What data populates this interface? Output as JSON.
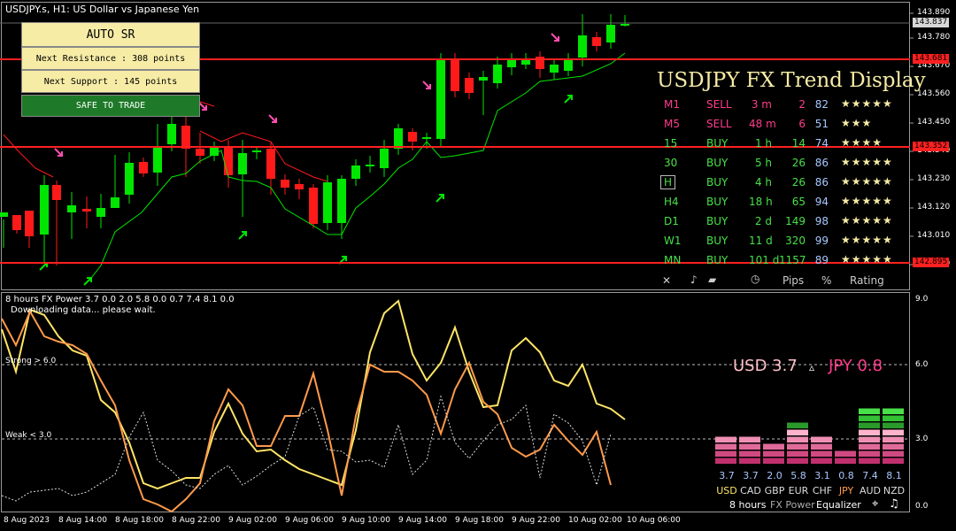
{
  "header": {
    "symbol_title": "USDJPY.s, H1:  US Dollar vs Japanese Yen",
    "indicator_title": "8 hours FX Power 3.7 0.0 2.0 5.8 0.0 0.7 7.4 8.1 0.0",
    "status_message": "Downloading data... please wait."
  },
  "sr_panel": {
    "auto_sr": "AUTO  SR",
    "next_resistance": "Next Resistance : 308 points",
    "next_support": "Next Support : 145 points",
    "safe_to_trade": "SAFE TO TRADE"
  },
  "price_axis": {
    "ticks": [
      "143.890",
      "143.780",
      "143.670",
      "143.560",
      "143.450",
      "143.340",
      "143.230",
      "143.120",
      "143.010",
      "142.900"
    ],
    "current_price_tag": "143.837",
    "resistance_tag": "143.681",
    "mid_tag": "143.352",
    "support_tag": "142.895"
  },
  "trend_display": {
    "title": "USDJPY FX Trend Display",
    "rows": [
      {
        "tf": "M1",
        "dir": "SELL",
        "time": "3 m",
        "pips": "2",
        "pct": "82",
        "stars": "★★★★★",
        "color": "#ff3c8c"
      },
      {
        "tf": "M5",
        "dir": "SELL",
        "time": "48 m",
        "pips": "6",
        "pct": "51",
        "stars": "★★★",
        "color": "#ff3c8c"
      },
      {
        "tf": "15",
        "dir": "BUY",
        "time": "1 h",
        "pips": "14",
        "pct": "74",
        "stars": "★★★★",
        "color": "#48e048"
      },
      {
        "tf": "30",
        "dir": "BUY",
        "time": "5 h",
        "pips": "26",
        "pct": "86",
        "stars": "★★★★★",
        "color": "#48e048"
      },
      {
        "tf": "H",
        "dir": "BUY",
        "time": "4 h",
        "pips": "26",
        "pct": "86",
        "stars": "★★★★★",
        "color": "#48e048"
      },
      {
        "tf": "H4",
        "dir": "BUY",
        "time": "18 h",
        "pips": "65",
        "pct": "94",
        "stars": "★★★★★",
        "color": "#48e048"
      },
      {
        "tf": "D1",
        "dir": "BUY",
        "time": "2 d",
        "pips": "149",
        "pct": "98",
        "stars": "★★★★★",
        "color": "#48e048"
      },
      {
        "tf": "W1",
        "dir": "BUY",
        "time": "11 d",
        "pips": "320",
        "pct": "99",
        "stars": "★★★★★",
        "color": "#48e048"
      },
      {
        "tf": "MN",
        "dir": "BUY",
        "time": "101 d",
        "pips": "1157",
        "pct": "89",
        "stars": "★★★★★",
        "color": "#48e048"
      }
    ],
    "footer": {
      "close": "✕",
      "pips": "Pips",
      "percent": "%",
      "rating": "Rating"
    }
  },
  "indicator": {
    "axis_ticks": [
      "9.0",
      "6.0",
      "3.0",
      "0.0"
    ],
    "strong_label": "Strong > 6.0",
    "weak_label": "Weak < 3.0",
    "pair_base": "USD 3.7",
    "pair_arrow": "▵",
    "pair_quote": "JPY 0.8",
    "currencies": [
      {
        "name": "USD",
        "value": "3.7",
        "level": 3.7
      },
      {
        "name": "CAD",
        "value": "3.7",
        "level": 3.7
      },
      {
        "name": "GBP",
        "value": "2.0",
        "level": 2.0
      },
      {
        "name": "EUR",
        "value": "5.8",
        "level": 5.8
      },
      {
        "name": "CHF",
        "value": "3.1",
        "level": 3.1
      },
      {
        "name": "JPY",
        "value": "0.8",
        "level": 0.8
      },
      {
        "name": "AUD",
        "value": "7.4",
        "level": 7.4
      },
      {
        "name": "NZD",
        "value": "8.1",
        "level": 8.1
      }
    ],
    "footer": {
      "period": "8 hours",
      "name": "FX Power",
      "mode": "Equalizer"
    }
  },
  "time_axis": [
    "8 Aug 2023",
    "8 Aug 14:00",
    "8 Aug 18:00",
    "8 Aug 22:00",
    "9 Aug 02:00",
    "9 Aug 06:00",
    "9 Aug 10:00",
    "9 Aug 14:00",
    "9 Aug 18:00",
    "9 Aug 22:00",
    "10 Aug 02:00",
    "10 Aug 06:00"
  ],
  "colors": {
    "bull": "#00e600",
    "bear": "#ff1a1a",
    "sr_line": "#ff2020",
    "sell": "#ff3c8c",
    "buy": "#48e048",
    "usd_line": "#ffe566",
    "jpy_line": "#ff9a4a",
    "star": "#f7eca6",
    "safe_bg": "#1e7a28"
  }
}
